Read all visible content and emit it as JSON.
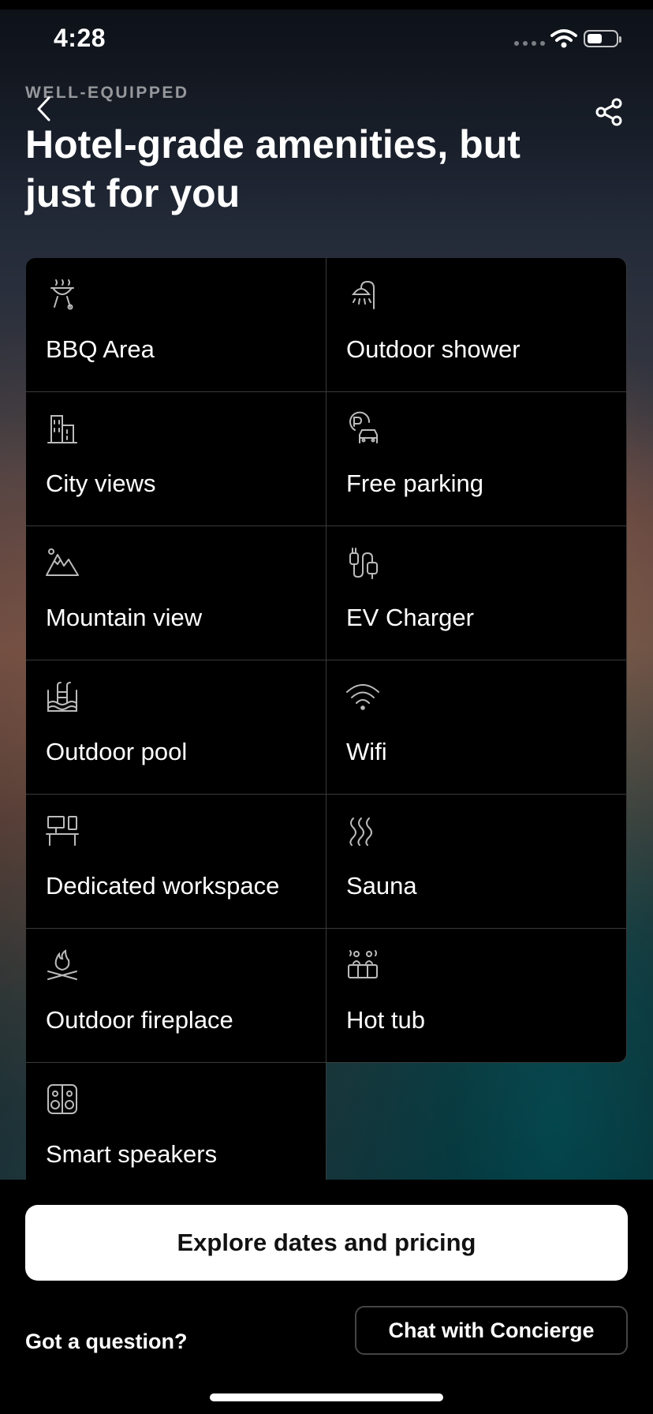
{
  "status_bar": {
    "time": "4:28"
  },
  "header": {
    "eyebrow": "WELL-EQUIPPED",
    "title": "Hotel-grade amenities, but just for you"
  },
  "amenities": [
    {
      "label": "BBQ Area",
      "icon": "bbq-grill-icon"
    },
    {
      "label": "Outdoor shower",
      "icon": "shower-icon"
    },
    {
      "label": "City views",
      "icon": "city-buildings-icon"
    },
    {
      "label": "Free parking",
      "icon": "parking-car-icon"
    },
    {
      "label": "Mountain view",
      "icon": "mountain-icon"
    },
    {
      "label": "EV Charger",
      "icon": "ev-charger-icon"
    },
    {
      "label": "Outdoor pool",
      "icon": "pool-icon"
    },
    {
      "label": "Wifi",
      "icon": "wifi-icon"
    },
    {
      "label": "Dedicated workspace",
      "icon": "workspace-desk-icon"
    },
    {
      "label": "Sauna",
      "icon": "sauna-heat-icon"
    },
    {
      "label": "Outdoor fireplace",
      "icon": "fire-pit-icon"
    },
    {
      "label": "Hot tub",
      "icon": "hot-tub-icon"
    },
    {
      "label": "Smart speakers",
      "icon": "speaker-icon"
    }
  ],
  "footer": {
    "primary_button": "Explore dates and pricing",
    "question": "Got a question?",
    "secondary_button": "Chat with Concierge"
  }
}
